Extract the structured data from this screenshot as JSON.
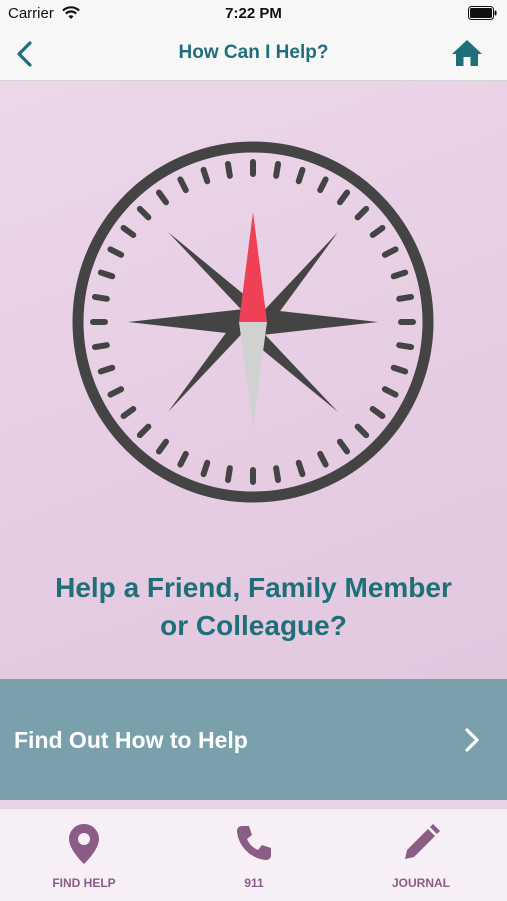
{
  "status": {
    "carrier": "Carrier",
    "time": "7:22 PM"
  },
  "nav": {
    "title": "How Can I Help?",
    "back_icon": "chevron-left-icon",
    "home_icon": "home-icon"
  },
  "hero": {
    "heading_line1": "Help a Friend, Family Member",
    "heading_line2": "or Colleague?",
    "compass_icon": "compass-icon"
  },
  "cta": {
    "label": "Find Out How to Help",
    "icon": "chevron-right-icon"
  },
  "tabs": [
    {
      "label": "FIND HELP",
      "icon": "map-pin-icon"
    },
    {
      "label": "911",
      "icon": "phone-icon"
    },
    {
      "label": "JOURNAL",
      "icon": "pencil-icon"
    }
  ],
  "colors": {
    "accent_teal": "#1f6f7a",
    "cta_bg": "#7aa0ab",
    "background": "#e8d2e6",
    "tab_purple": "#8a5c86",
    "compass_dark": "#444444",
    "needle_red": "#ee4156"
  }
}
